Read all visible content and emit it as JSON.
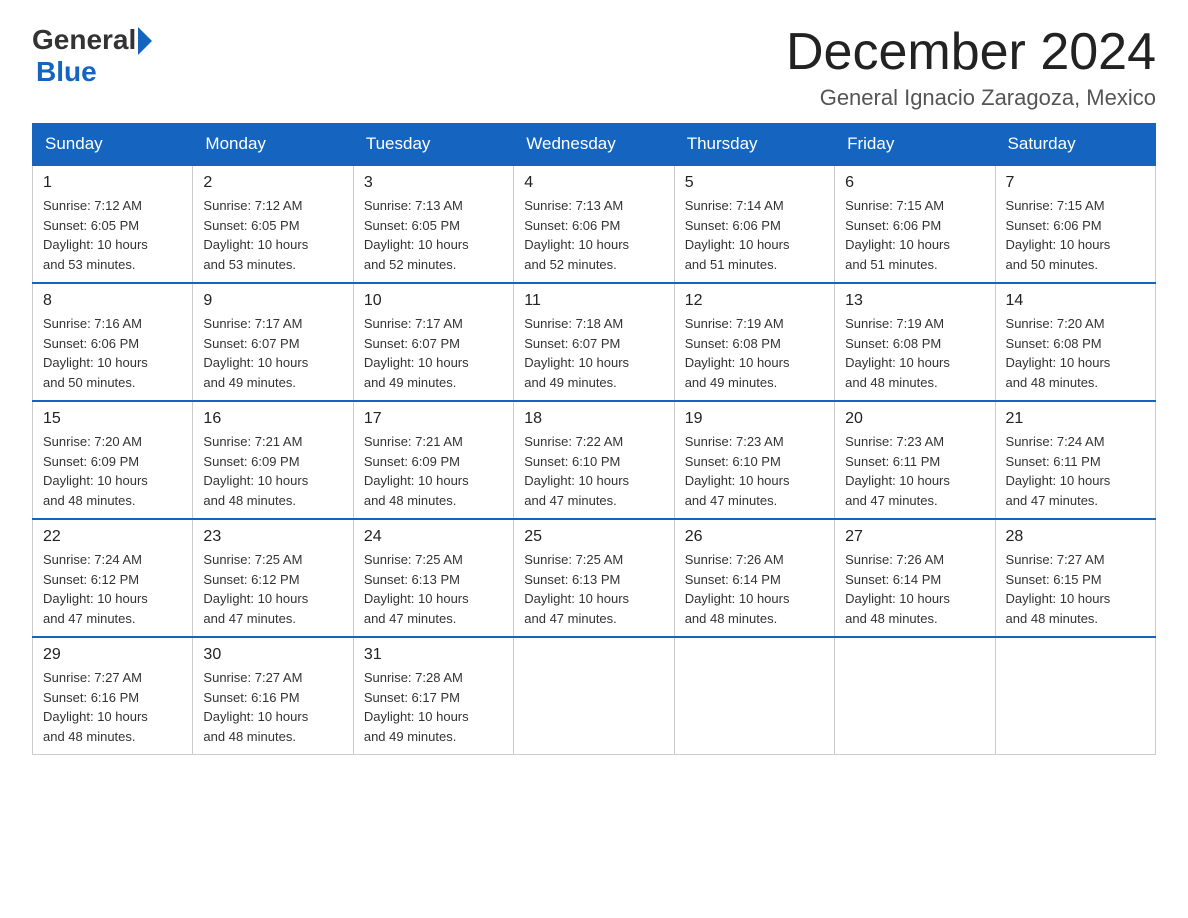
{
  "header": {
    "logo_general": "General",
    "logo_blue": "Blue",
    "month_title": "December 2024",
    "location": "General Ignacio Zaragoza, Mexico"
  },
  "days_of_week": [
    "Sunday",
    "Monday",
    "Tuesday",
    "Wednesday",
    "Thursday",
    "Friday",
    "Saturday"
  ],
  "weeks": [
    [
      {
        "day": "1",
        "sunrise": "7:12 AM",
        "sunset": "6:05 PM",
        "daylight": "10 hours and 53 minutes."
      },
      {
        "day": "2",
        "sunrise": "7:12 AM",
        "sunset": "6:05 PM",
        "daylight": "10 hours and 53 minutes."
      },
      {
        "day": "3",
        "sunrise": "7:13 AM",
        "sunset": "6:05 PM",
        "daylight": "10 hours and 52 minutes."
      },
      {
        "day": "4",
        "sunrise": "7:13 AM",
        "sunset": "6:06 PM",
        "daylight": "10 hours and 52 minutes."
      },
      {
        "day": "5",
        "sunrise": "7:14 AM",
        "sunset": "6:06 PM",
        "daylight": "10 hours and 51 minutes."
      },
      {
        "day": "6",
        "sunrise": "7:15 AM",
        "sunset": "6:06 PM",
        "daylight": "10 hours and 51 minutes."
      },
      {
        "day": "7",
        "sunrise": "7:15 AM",
        "sunset": "6:06 PM",
        "daylight": "10 hours and 50 minutes."
      }
    ],
    [
      {
        "day": "8",
        "sunrise": "7:16 AM",
        "sunset": "6:06 PM",
        "daylight": "10 hours and 50 minutes."
      },
      {
        "day": "9",
        "sunrise": "7:17 AM",
        "sunset": "6:07 PM",
        "daylight": "10 hours and 49 minutes."
      },
      {
        "day": "10",
        "sunrise": "7:17 AM",
        "sunset": "6:07 PM",
        "daylight": "10 hours and 49 minutes."
      },
      {
        "day": "11",
        "sunrise": "7:18 AM",
        "sunset": "6:07 PM",
        "daylight": "10 hours and 49 minutes."
      },
      {
        "day": "12",
        "sunrise": "7:19 AM",
        "sunset": "6:08 PM",
        "daylight": "10 hours and 49 minutes."
      },
      {
        "day": "13",
        "sunrise": "7:19 AM",
        "sunset": "6:08 PM",
        "daylight": "10 hours and 48 minutes."
      },
      {
        "day": "14",
        "sunrise": "7:20 AM",
        "sunset": "6:08 PM",
        "daylight": "10 hours and 48 minutes."
      }
    ],
    [
      {
        "day": "15",
        "sunrise": "7:20 AM",
        "sunset": "6:09 PM",
        "daylight": "10 hours and 48 minutes."
      },
      {
        "day": "16",
        "sunrise": "7:21 AM",
        "sunset": "6:09 PM",
        "daylight": "10 hours and 48 minutes."
      },
      {
        "day": "17",
        "sunrise": "7:21 AM",
        "sunset": "6:09 PM",
        "daylight": "10 hours and 48 minutes."
      },
      {
        "day": "18",
        "sunrise": "7:22 AM",
        "sunset": "6:10 PM",
        "daylight": "10 hours and 47 minutes."
      },
      {
        "day": "19",
        "sunrise": "7:23 AM",
        "sunset": "6:10 PM",
        "daylight": "10 hours and 47 minutes."
      },
      {
        "day": "20",
        "sunrise": "7:23 AM",
        "sunset": "6:11 PM",
        "daylight": "10 hours and 47 minutes."
      },
      {
        "day": "21",
        "sunrise": "7:24 AM",
        "sunset": "6:11 PM",
        "daylight": "10 hours and 47 minutes."
      }
    ],
    [
      {
        "day": "22",
        "sunrise": "7:24 AM",
        "sunset": "6:12 PM",
        "daylight": "10 hours and 47 minutes."
      },
      {
        "day": "23",
        "sunrise": "7:25 AM",
        "sunset": "6:12 PM",
        "daylight": "10 hours and 47 minutes."
      },
      {
        "day": "24",
        "sunrise": "7:25 AM",
        "sunset": "6:13 PM",
        "daylight": "10 hours and 47 minutes."
      },
      {
        "day": "25",
        "sunrise": "7:25 AM",
        "sunset": "6:13 PM",
        "daylight": "10 hours and 47 minutes."
      },
      {
        "day": "26",
        "sunrise": "7:26 AM",
        "sunset": "6:14 PM",
        "daylight": "10 hours and 48 minutes."
      },
      {
        "day": "27",
        "sunrise": "7:26 AM",
        "sunset": "6:14 PM",
        "daylight": "10 hours and 48 minutes."
      },
      {
        "day": "28",
        "sunrise": "7:27 AM",
        "sunset": "6:15 PM",
        "daylight": "10 hours and 48 minutes."
      }
    ],
    [
      {
        "day": "29",
        "sunrise": "7:27 AM",
        "sunset": "6:16 PM",
        "daylight": "10 hours and 48 minutes."
      },
      {
        "day": "30",
        "sunrise": "7:27 AM",
        "sunset": "6:16 PM",
        "daylight": "10 hours and 48 minutes."
      },
      {
        "day": "31",
        "sunrise": "7:28 AM",
        "sunset": "6:17 PM",
        "daylight": "10 hours and 49 minutes."
      },
      null,
      null,
      null,
      null
    ]
  ],
  "labels": {
    "sunrise": "Sunrise:",
    "sunset": "Sunset:",
    "daylight": "Daylight:"
  }
}
